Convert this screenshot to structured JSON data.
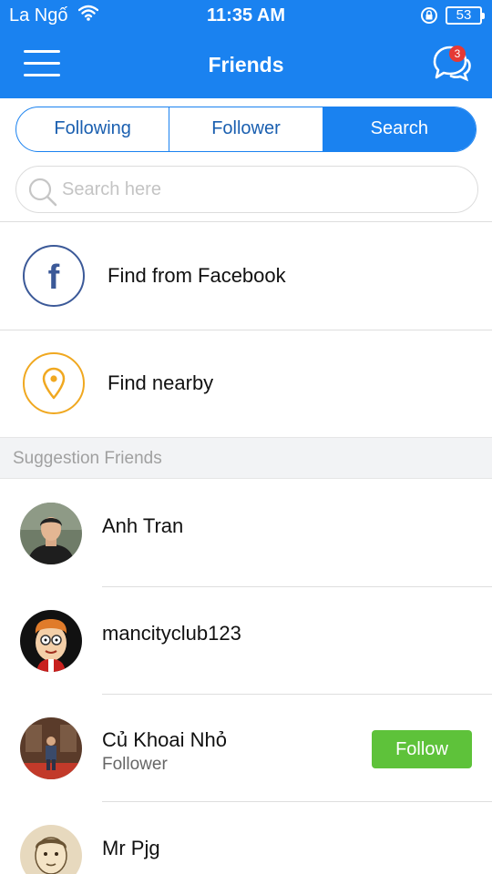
{
  "status_bar": {
    "carrier": "La Ngố",
    "time": "11:35 AM",
    "battery": "53"
  },
  "nav": {
    "title": "Friends",
    "chat_badge": "3"
  },
  "tabs": [
    {
      "label": "Following",
      "active": false
    },
    {
      "label": "Follower",
      "active": false
    },
    {
      "label": "Search",
      "active": true
    }
  ],
  "search": {
    "placeholder": "Search here",
    "value": ""
  },
  "find_options": [
    {
      "label": "Find from Facebook",
      "icon": "facebook-icon",
      "color": "#3b5998"
    },
    {
      "label": "Find nearby",
      "icon": "location-pin-icon",
      "color": "#f0a820"
    }
  ],
  "section_title": "Suggestion Friends",
  "suggestions": [
    {
      "name": "Anh Tran",
      "subtitle": "",
      "show_follow": false
    },
    {
      "name": "mancityclub123",
      "subtitle": "",
      "show_follow": false
    },
    {
      "name": "Củ Khoai Nhỏ",
      "subtitle": "Follower",
      "show_follow": true,
      "follow_label": "Follow"
    },
    {
      "name": "Mr Pjg",
      "subtitle": "",
      "show_follow": false
    }
  ],
  "colors": {
    "primary": "#1a82f0",
    "follow": "#5ec23a",
    "badge": "#e53935"
  }
}
